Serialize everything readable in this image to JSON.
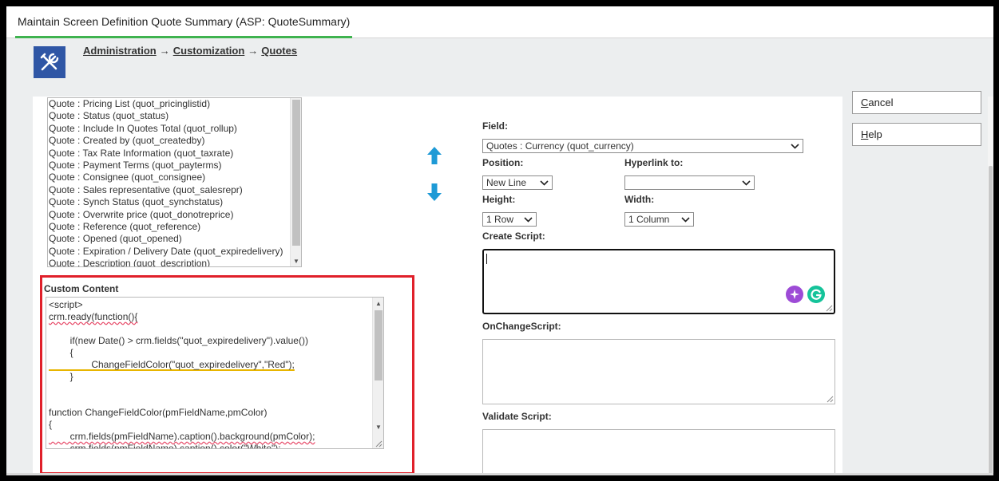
{
  "window": {
    "title": "Maintain Screen Definition Quote Summary (ASP: QuoteSummary)"
  },
  "breadcrumb": {
    "items": [
      "Administration",
      "Customization",
      "Quotes"
    ],
    "separator": "→"
  },
  "field_list": {
    "items": [
      "Quote : Pricing List (quot_pricinglistid)",
      "Quote : Status (quot_status)",
      "Quote : Include In Quotes Total (quot_rollup)",
      "Quote : Created by (quot_createdby)",
      "Quote : Tax Rate Information (quot_taxrate)",
      "Quote : Payment Terms (quot_payterms)",
      "Quote : Consignee (quot_consignee)",
      "Quote : Sales representative (quot_salesrepr)",
      "Quote : Synch Status (quot_synchstatus)",
      "Quote : Overwrite price (quot_donotreprice)",
      "Quote : Reference (quot_reference)",
      "Quote : Opened (quot_opened)",
      "Quote : Expiration / Delivery Date (quot_expiredelivery)",
      "Quote : Description (quot_description)"
    ]
  },
  "custom_content": {
    "label": "Custom Content",
    "lines": [
      "<script>",
      "crm.ready(function(){",
      "",
      "        if(new Date() > crm.fields(\"quot_expiredelivery\").value())",
      "        {",
      "                ChangeFieldColor(\"quot_expiredelivery\",\"Red\");",
      "        }",
      "",
      "",
      "function ChangeFieldColor(pmFieldName,pmColor)",
      "{",
      "        crm.fields(pmFieldName).caption().background(pmColor);",
      "        crm.fields(pmFieldName).caption().color(\"White\");"
    ]
  },
  "form": {
    "field_label": "Field:",
    "field_value": "Quotes : Currency (quot_currency)",
    "position_label": "Position:",
    "position_value": "New Line",
    "hyperlink_label": "Hyperlink to:",
    "hyperlink_value": "",
    "height_label": "Height:",
    "height_value": "1 Row",
    "width_label": "Width:",
    "width_value": "1 Column",
    "create_script_label": "Create Script:",
    "onchange_script_label": "OnChangeScript:",
    "validate_script_label": "Validate Script:"
  },
  "buttons": {
    "cancel": {
      "first": "C",
      "rest": "ancel"
    },
    "help": {
      "first": "H",
      "rest": "elp"
    }
  },
  "icons": {
    "app_logo": "tools-icon",
    "move_up": "arrow-up-icon",
    "move_down": "arrow-down-icon",
    "ai_assist": "sparkle-icon",
    "grammarly": "grammarly-icon"
  },
  "colors": {
    "accent_green": "#3fb34f",
    "logo_blue": "#2f56a5",
    "arrow_blue": "#1e9ad6",
    "highlight_red": "#e0202a",
    "ai_purple": "#9d4bd6",
    "grammarly_green": "#15c39a"
  }
}
